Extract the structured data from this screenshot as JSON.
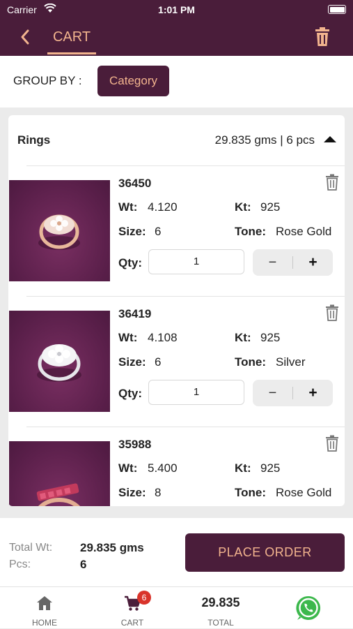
{
  "status_bar": {
    "carrier": "Carrier",
    "time": "1:01 PM"
  },
  "header": {
    "title": "CART",
    "accent_color": "#f2b48e",
    "brand_color": "#4a1d3a"
  },
  "group_by": {
    "label": "GROUP BY :",
    "value": "Category"
  },
  "category": {
    "name": "Rings",
    "summary": "29.835 gms | 6 pcs",
    "items": [
      {
        "sku": "36450",
        "wt_label": "Wt:",
        "wt": "4.120",
        "kt_label": "Kt:",
        "kt": "925",
        "size_label": "Size:",
        "size": "6",
        "tone_label": "Tone:",
        "tone": "Rose Gold",
        "qty_label": "Qty:",
        "qty": "1",
        "minus": "−",
        "plus": "+",
        "ring_color": "rose-gold"
      },
      {
        "sku": "36419",
        "wt_label": "Wt:",
        "wt": "4.108",
        "kt_label": "Kt:",
        "kt": "925",
        "size_label": "Size:",
        "size": "6",
        "tone_label": "Tone:",
        "tone": "Silver",
        "qty_label": "Qty:",
        "qty": "1",
        "minus": "−",
        "plus": "+",
        "ring_color": "silver"
      },
      {
        "sku": "35988",
        "wt_label": "Wt:",
        "wt": "5.400",
        "kt_label": "Kt:",
        "kt": "925",
        "size_label": "Size:",
        "size": "8",
        "tone_label": "Tone:",
        "tone": "Rose Gold",
        "ring_color": "rose-gold-ruby"
      }
    ]
  },
  "footer": {
    "total_wt_label": "Total Wt:",
    "total_wt": "29.835 gms",
    "pcs_label": "Pcs:",
    "pcs": "6",
    "place_order": "PLACE ORDER"
  },
  "tabbar": {
    "home": "HOME",
    "cart": "CART",
    "cart_badge": "6",
    "total_value": "29.835",
    "total": "TOTAL",
    "whatsapp_icon": "whatsapp-icon"
  }
}
